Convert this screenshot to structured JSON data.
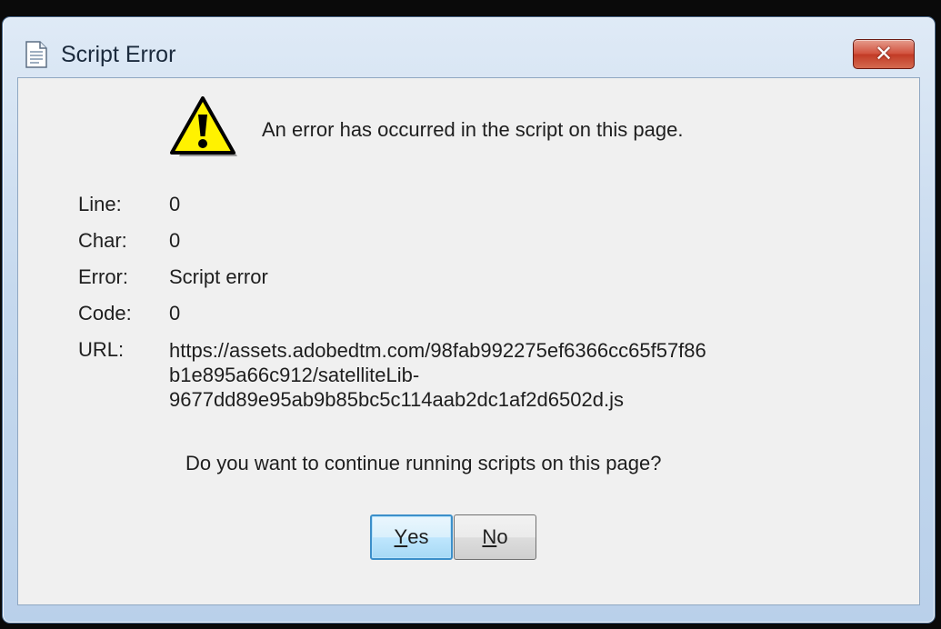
{
  "window": {
    "title": "Script Error",
    "close_label": "✕"
  },
  "dialog": {
    "message": "An error has occurred in the script on this page.",
    "fields": [
      {
        "label": "Line:",
        "value": "0"
      },
      {
        "label": "Char:",
        "value": "0"
      },
      {
        "label": "Error:",
        "value": "Script error"
      },
      {
        "label": "Code:",
        "value": "0"
      },
      {
        "label": "URL:",
        "value_lines": [
          "https://assets.adobedtm.com/98fab992275ef6366cc65f57f86",
          "b1e895a66c912/satelliteLib-",
          "9677dd89e95ab9b85bc5c114aab2dc1af2d6502d.js"
        ]
      }
    ],
    "question": "Do you want to continue running scripts on this page?"
  },
  "buttons": {
    "yes": {
      "mnemonic": "Y",
      "rest": "es"
    },
    "no": {
      "mnemonic": "N",
      "rest": "o"
    }
  },
  "icons": {
    "document": "document-icon",
    "warning": "warning-icon",
    "close": "close-icon"
  },
  "colors": {
    "close_button": "#d2533f",
    "warning_fill": "#fff200",
    "default_button_border": "#3c8fc9"
  }
}
